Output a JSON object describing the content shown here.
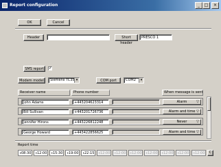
{
  "window": {
    "title": "Report configuration"
  },
  "toolbar": {
    "ok_label": "OK",
    "cancel_label": "Cancel"
  },
  "header_section": {
    "header_label": "Header",
    "header_value": "",
    "short_header_label": "Short header",
    "short_header_value": "PRESCO 1"
  },
  "sms": {
    "label": "SMS report",
    "checked": "✓"
  },
  "modem": {
    "label": "Modem model",
    "value": "Siemens TC35T",
    "com_label": "COM port",
    "com_value": "COM2"
  },
  "table": {
    "col_receiver": "Receiver name",
    "col_phone": "Phone number",
    "col_when": "When message is sent",
    "rows": [
      {
        "name": "John Adams",
        "phone": "+443204623314",
        "when": "Alarm"
      },
      {
        "name": "Bill Sullivan",
        "phone": "+443201726736",
        "when": "Alarm and time"
      },
      {
        "name": "Jennifer Hirons",
        "phone": "+443226812248",
        "when": "Never"
      },
      {
        "name": "George Howard",
        "phone": "+443422856625",
        "when": "Alarm and time"
      }
    ]
  },
  "report_time": {
    "label": "Report time",
    "times": [
      "08:30",
      "12:00",
      "15:30",
      "19:00",
      "22:15",
      "12:00",
      "12:00",
      "12:00",
      "12:00",
      "12:00",
      "12:00",
      "12:00"
    ],
    "clear_label": "C"
  }
}
